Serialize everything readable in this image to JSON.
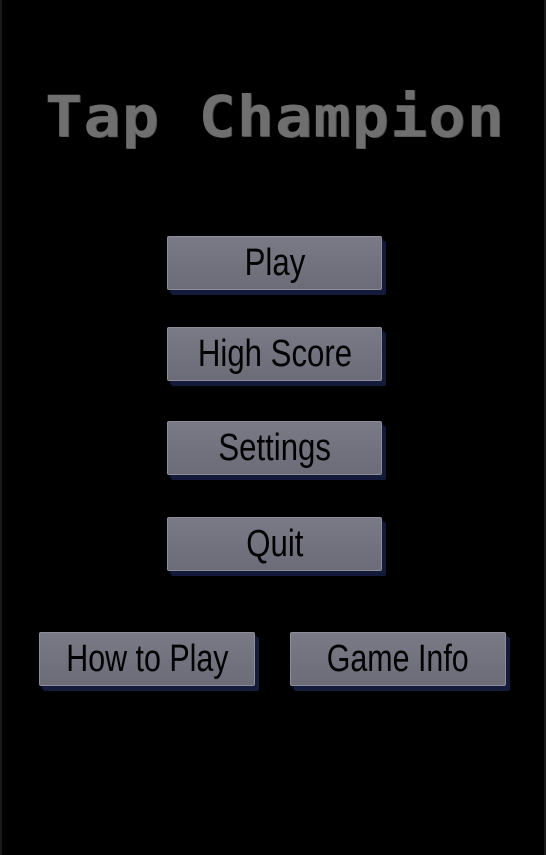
{
  "game": {
    "title": "Tap Champion"
  },
  "menu": {
    "play_label": "Play",
    "high_score_label": "High Score",
    "settings_label": "Settings",
    "quit_label": "Quit",
    "how_to_play_label": "How to Play",
    "game_info_label": "Game Info"
  },
  "colors": {
    "background": "#000000",
    "title": "#6f6f6f",
    "button_fill": "#74747f",
    "button_shadow": "#141a3a",
    "button_text": "#000000"
  }
}
